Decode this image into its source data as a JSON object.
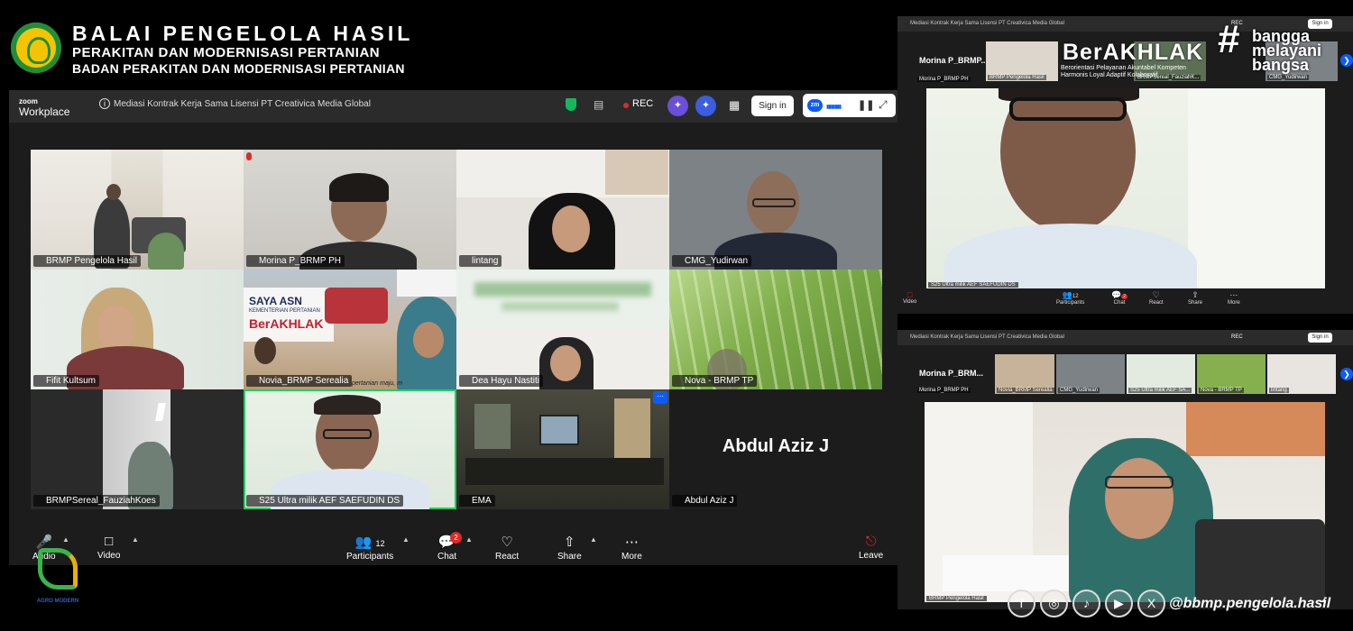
{
  "banner": {
    "line1": "BALAI PENGELOLA HASIL",
    "line2": "PERAKITAN DAN MODERNISASI PERTANIAN",
    "line3": "BADAN PERAKITAN DAN MODERNISASI PERTANIAN"
  },
  "window": {
    "brand_top": "zoom",
    "brand_bottom": "Workplace",
    "meeting_title": "Mediasi Kontrak Kerja Sama Lisensi PT Creativica Media Global",
    "rec_label": "REC",
    "sign_in_label": "Sign in"
  },
  "participants": [
    {
      "name": "BRMP Pengelola Hasil"
    },
    {
      "name": "Morina P_BRMP PH"
    },
    {
      "name": "lintang"
    },
    {
      "name": "CMG_Yudirwan"
    },
    {
      "name": "Fifit Kultsum"
    },
    {
      "name": "Novia_BRMP Serealia"
    },
    {
      "name": "Dea Hayu Nastiti"
    },
    {
      "name": "Nova - BRMP TP"
    },
    {
      "name": "BRMPSereal_FauziahKoes"
    },
    {
      "name": "S25 Ultra milik AEF SAEFUDIN DS"
    },
    {
      "name": "EMA"
    },
    {
      "name": "Abdul Aziz J"
    }
  ],
  "tile_overlays": {
    "novia_banner_1": "SAYA ASN",
    "novia_banner_2": "KEMENTERIAN PERTANIAN",
    "novia_banner_3": "BerAKHLAK",
    "novia_caption": "pertanian maju, m"
  },
  "toolbar": {
    "audio": "Audio",
    "video": "Video",
    "participants": "Participants",
    "participants_count": "12",
    "chat": "Chat",
    "chat_badge": "2",
    "react": "React",
    "share": "Share",
    "more": "More",
    "leave": "Leave"
  },
  "agro_logo_text": "AGRO MODERN",
  "right_top": {
    "meeting_title": "Mediasi Kontrak Kerja Sama Lisensi PT Creativica Media Global",
    "rec_label": "REC",
    "sign_in_label": "Sign in",
    "active_speaker_label": "Morina P_BRMP...",
    "strip": [
      {
        "name": "Morina P_BRMP PH"
      },
      {
        "name": "BRMP Pengelola Hasil"
      },
      {
        "name": "BRMPSereal_FauziahK..."
      },
      {
        "name": "CMG_Yudirwan"
      }
    ],
    "main_video_name": "S25 Ultra milik AEF SAEFUDIN DS",
    "tools": {
      "video": "Video",
      "participants": "Participants",
      "participants_count": "12",
      "chat": "Chat",
      "chat_badge": "2",
      "react": "React",
      "share": "Share",
      "more": "More"
    }
  },
  "right_bottom": {
    "meeting_title": "Mediasi Kontrak Kerja Sama Lisensi PT Creativica Media Global",
    "rec_label": "REC",
    "sign_in_label": "Sign in",
    "active_speaker_label": "Morina P_BRM...",
    "strip": [
      {
        "name": "Morina P_BRMP PH"
      },
      {
        "name": "Novia_BRMP Serealia"
      },
      {
        "name": "CMG_Yudirwan"
      },
      {
        "name": "S25 Ultra milik AEF SA..."
      },
      {
        "name": "Nova - BRMP TP"
      },
      {
        "name": "lintang"
      }
    ],
    "main_video_name": "BRMP Pengelola Hasil"
  },
  "overlay": {
    "berakhlak": "BerAKHLAK",
    "berakhlak_sub": "Berorientasi Pelayanan Akuntabel Kompeten Harmonis Loyal Adaptif Kolaboratif",
    "bangga_1": "bangga",
    "bangga_2": "melayani",
    "bangga_3": "bangsa",
    "social_handle": "@bbmp.pengelola.hasil"
  }
}
